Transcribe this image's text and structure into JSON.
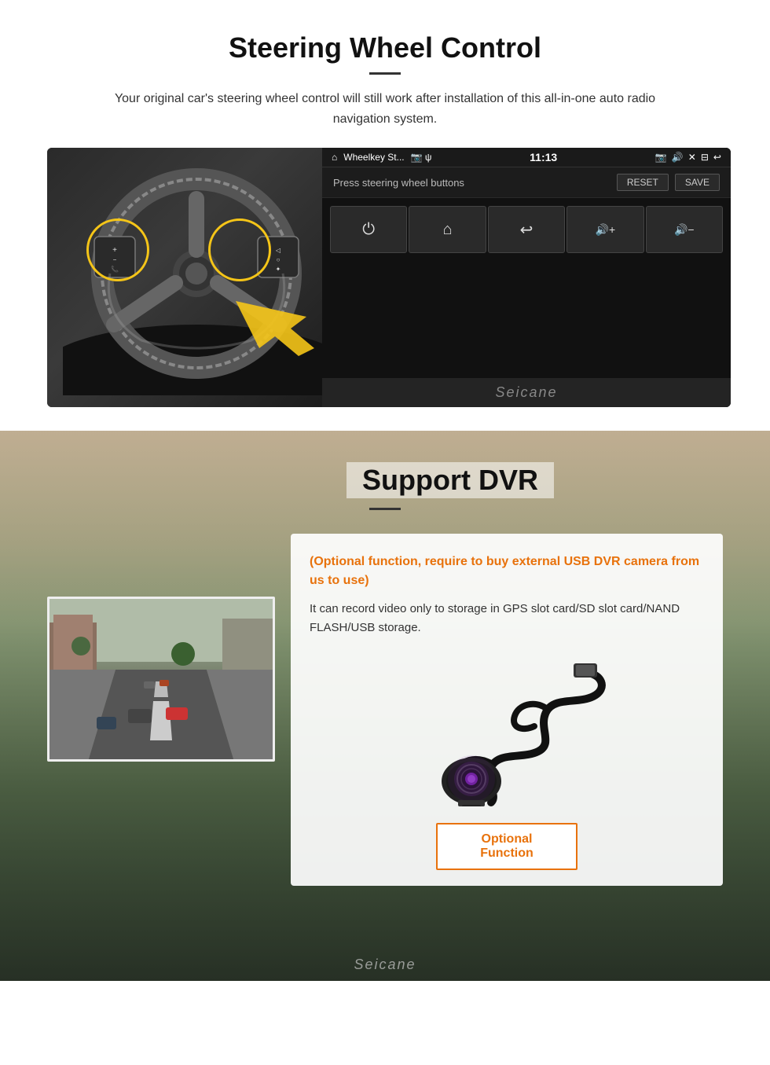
{
  "steering": {
    "title": "Steering Wheel Control",
    "subtitle": "Your original car's steering wheel control will still work after installation of this all-in-one auto radio navigation system.",
    "ui": {
      "statusbar": {
        "app": "Wheelkey St...",
        "icons": "📷 ψ",
        "time": "11:13",
        "right_icons": "🔊 ✕ ↩"
      },
      "header_label": "Press steering wheel buttons",
      "reset_btn": "RESET",
      "save_btn": "SAVE",
      "controls": [
        "⏻",
        "⌂",
        "↩",
        "🔊+",
        "🔊-"
      ]
    },
    "watermark": "Seicane"
  },
  "dvr": {
    "title": "Support DVR",
    "optional_text": "(Optional function, require to buy external USB DVR camera from us to use)",
    "description": "It can record video only to storage in GPS slot card/SD slot card/NAND FLASH/USB storage.",
    "optional_btn_label": "Optional Function",
    "watermark": "Seicane"
  }
}
